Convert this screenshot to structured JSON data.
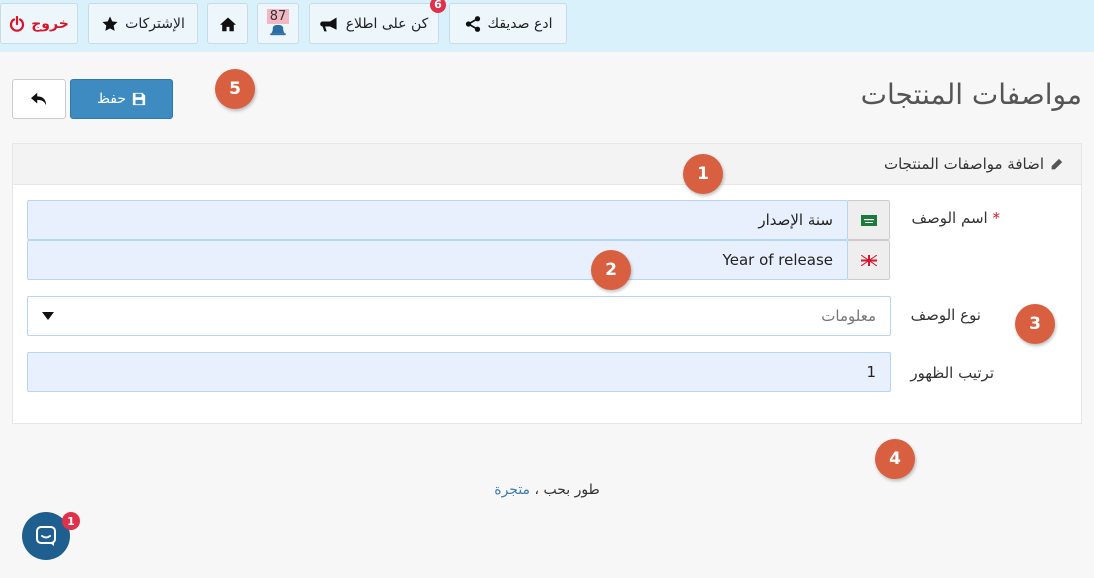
{
  "topbar": {
    "logout_label": "خروج",
    "subscriptions_label": "الإشتركات",
    "notifications_count": "87",
    "stay_informed_label": "كن على اطلاع",
    "stay_informed_badge": "6",
    "invite_friend_label": "ادع صديقك"
  },
  "header": {
    "page_title": "مواصفات المنتجات",
    "save_label": "حفظ"
  },
  "panel": {
    "title": "اضافة مواصفات المنتجات"
  },
  "form": {
    "name_label": "اسم الوصف",
    "name_required_mark": "*",
    "name_ar_value": "سنة الإصدار",
    "name_en_value": "Year of release",
    "type_label": "نوع الوصف",
    "type_selected": "معلومات",
    "order_label": "ترتيب الظهور",
    "order_value": "1"
  },
  "footer": {
    "prefix": "طور بحب ،",
    "brand_link": "متجرة"
  },
  "markers": [
    "1",
    "2",
    "3",
    "4",
    "5"
  ],
  "chat": {
    "badge": "1"
  },
  "colors": {
    "topbar_bg": "#d8f1fb",
    "primary": "#3d8bc0",
    "danger": "#d9142a",
    "marker": "#d85f3f",
    "field_bg": "#e9f0fd"
  }
}
